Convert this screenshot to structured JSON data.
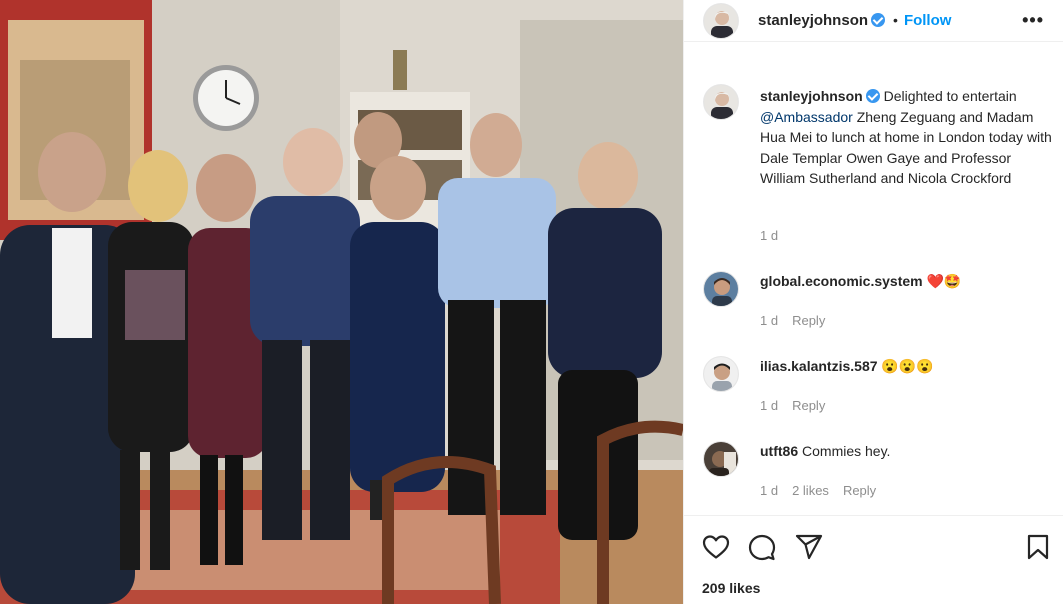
{
  "post": {
    "author": "stanleyjohnson",
    "follow_label": "Follow",
    "dot": "•",
    "more_label": "•••"
  },
  "caption": {
    "username": "stanleyjohnson",
    "text_before": " Delighted to entertain ",
    "mention": "@Ambassador",
    "text_after": " Zheng Zeguang and Madam Hua Mei to lunch at home in London today with Dale Templar Owen Gaye and Professor William Sutherland and Nicola Crockford",
    "time": "1 d"
  },
  "comments": [
    {
      "username": "global.economic.system",
      "text": " ❤️🤩",
      "time": "1 d",
      "likes": "",
      "reply": "Reply"
    },
    {
      "username": "ilias.kalantzis.587",
      "text": " 😮😮😮",
      "time": "1 d",
      "likes": "",
      "reply": "Reply"
    },
    {
      "username": "utft86",
      "text": " Commies hey.",
      "time": "1 d",
      "likes": "2 likes",
      "reply": "Reply"
    }
  ],
  "footer": {
    "likes": "209 likes"
  },
  "icons": {
    "like": "heart-icon",
    "comment": "comment-icon",
    "share": "share-icon",
    "save": "bookmark-icon",
    "verified": "verified-badge-icon"
  },
  "colors": {
    "follow": "#0095f6",
    "mention": "#00376b",
    "verified": "#3897f0",
    "muted": "#8e8e8e"
  }
}
